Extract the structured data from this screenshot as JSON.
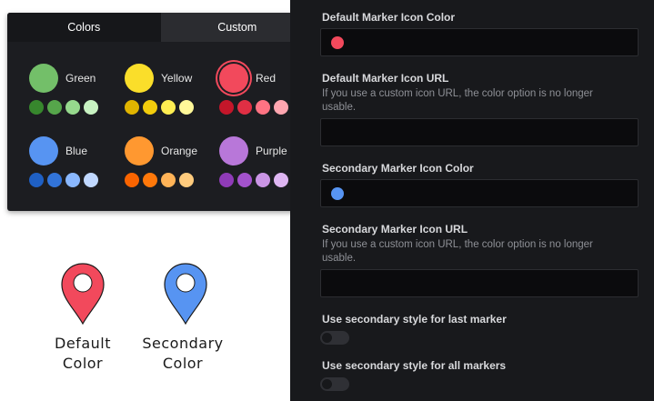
{
  "picker": {
    "tabs": [
      {
        "label": "Colors",
        "active": true
      },
      {
        "label": "Custom",
        "active": false
      }
    ],
    "groups": [
      {
        "name": "Green",
        "main": "#73bf69",
        "selected": false,
        "shades": [
          "#37872d",
          "#56a64b",
          "#96d98d",
          "#c8f2c2"
        ]
      },
      {
        "name": "Yellow",
        "main": "#fade2a",
        "selected": false,
        "shades": [
          "#e0b400",
          "#f2cc0c",
          "#ffee52",
          "#fff899"
        ]
      },
      {
        "name": "Red",
        "main": "#f2495c",
        "selected": true,
        "shades": [
          "#c4162a",
          "#e02f44",
          "#ff7383",
          "#ffa6b0"
        ]
      },
      {
        "name": "Blue",
        "main": "#5794f2",
        "selected": false,
        "shades": [
          "#1f60c4",
          "#3274d9",
          "#8ab8ff",
          "#c0d8ff"
        ]
      },
      {
        "name": "Orange",
        "main": "#ff9830",
        "selected": false,
        "shades": [
          "#fa6400",
          "#ff780a",
          "#ffb357",
          "#ffcb7d"
        ]
      },
      {
        "name": "Purple",
        "main": "#b877d9",
        "selected": false,
        "shades": [
          "#8f3bb8",
          "#a352cc",
          "#ca95e5",
          "#deb6f2"
        ]
      }
    ]
  },
  "markers": {
    "default": {
      "label_line1": "Default",
      "label_line2": "Color",
      "color": "#f2495c"
    },
    "secondary": {
      "label_line1": "Secondary",
      "label_line2": "Color",
      "color": "#5794f2"
    }
  },
  "settings": {
    "default_color": {
      "label": "Default Marker Icon Color",
      "value": "#f2495c"
    },
    "default_url": {
      "label": "Default Marker Icon URL",
      "help": "If you use a custom icon URL, the color option is no longer usable.",
      "value": ""
    },
    "secondary_color": {
      "label": "Secondary Marker Icon Color",
      "value": "#5794f2"
    },
    "secondary_url": {
      "label": "Secondary Marker Icon URL",
      "help": "If you use a custom icon URL, the color option is no longer usable.",
      "value": ""
    },
    "last_marker": {
      "label": "Use secondary style for last marker",
      "enabled": false
    },
    "all_markers": {
      "label": "Use secondary style for all markers",
      "enabled": false
    }
  }
}
